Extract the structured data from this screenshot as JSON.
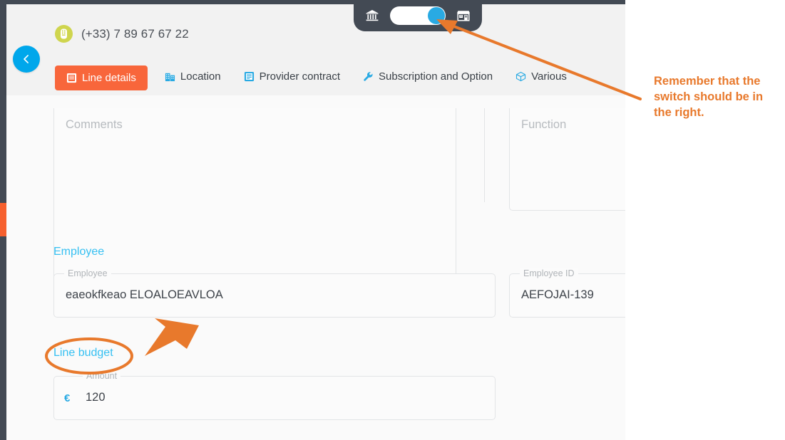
{
  "window": {
    "phone_number": "(+33) 7 89 67 67 22",
    "phone_icon": "phone-booth-icon",
    "back_icon": "chevron-left-icon"
  },
  "toggle": {
    "left_icon": "bank-icon",
    "right_icon": "store-icon",
    "state": "right",
    "knob_color": "#29aae3"
  },
  "tabs": [
    {
      "label": "Line details",
      "icon": "document-icon",
      "active": true
    },
    {
      "label": "Location",
      "icon": "building-icon",
      "active": false
    },
    {
      "label": "Provider contract",
      "icon": "document-icon",
      "active": false
    },
    {
      "label": "Subscription and Option",
      "icon": "wrench-icon",
      "active": false
    },
    {
      "label": "Various",
      "icon": "cube-icon",
      "active": false
    }
  ],
  "form": {
    "comments_placeholder": "Comments",
    "function_placeholder": "Function",
    "employee_section_title": "Employee",
    "employee_label": "Employee",
    "employee_value": "eaeokfkeao ELOALOEAVLOA",
    "employee_id_label": "Employee ID",
    "employee_id_value": "AEFOJAI-139",
    "line_budget_section_title": "Line budget",
    "amount_label": "Amount",
    "amount_currency": "€",
    "amount_value": "120"
  },
  "annotation": {
    "note": "Remember that the switch should be in the right.",
    "color": "#e8792c"
  },
  "colors": {
    "accent_orange": "#f8663b",
    "accent_blue": "#29aae3",
    "section_blue": "#36c0f2",
    "dark_chrome": "#434a54",
    "rail_active": "#f6602e",
    "phone_badge": "#cfd54e"
  }
}
